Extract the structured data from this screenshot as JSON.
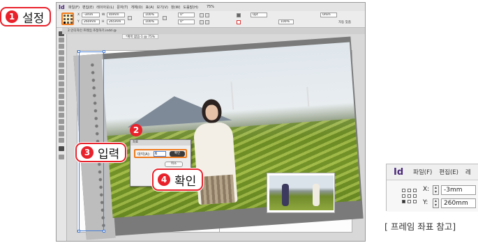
{
  "menubar": {
    "logo": "Id",
    "items": [
      "파일(F)",
      "편집(E)",
      "레이아웃(L)",
      "문자(T)",
      "개체(O)",
      "표(A)",
      "보기(V)",
      "창(W)",
      "도움말(H)"
    ],
    "zoom": "75%"
  },
  "controlbar": {
    "x_value": "-3mm",
    "y_value": "260mm",
    "w_value": "40mm",
    "h_value": "265mm",
    "scale_x": "100%",
    "scale_y": "100%",
    "rotate": "0°",
    "shear": "0°",
    "stroke": "0pt",
    "opacity": "100%",
    "gap": "0mm",
    "autofit": "자동 맞춤"
  },
  "doc": {
    "tab_title": "2.인디자인 프레임 조정하기.indd @ 75%",
    "sub_tab": "*제목 없음-1 @ 75%"
  },
  "dialog": {
    "title": "좌표",
    "field_label": "대각(A):",
    "field_value": "6",
    "ok_label": "확인",
    "cancel_label": "취소"
  },
  "callouts": {
    "step1": {
      "num": "1",
      "text": "설정"
    },
    "step2": {
      "num": "2"
    },
    "step3": {
      "num": "3",
      "text": "입력"
    },
    "step4": {
      "num": "4",
      "text": "확인"
    }
  },
  "reference": {
    "logo": "Id",
    "menu": [
      "파일(F)",
      "편집(E)",
      "레"
    ],
    "x_label": "X:",
    "x_value": "-3mm",
    "y_label": "Y:",
    "y_value": "260mm",
    "caption": "[ 프레임 좌표 참고]"
  },
  "colors": {
    "accent_orange": "#f07a1c",
    "callout_red": "#e8212b",
    "selection_blue": "#4a7fd4"
  }
}
